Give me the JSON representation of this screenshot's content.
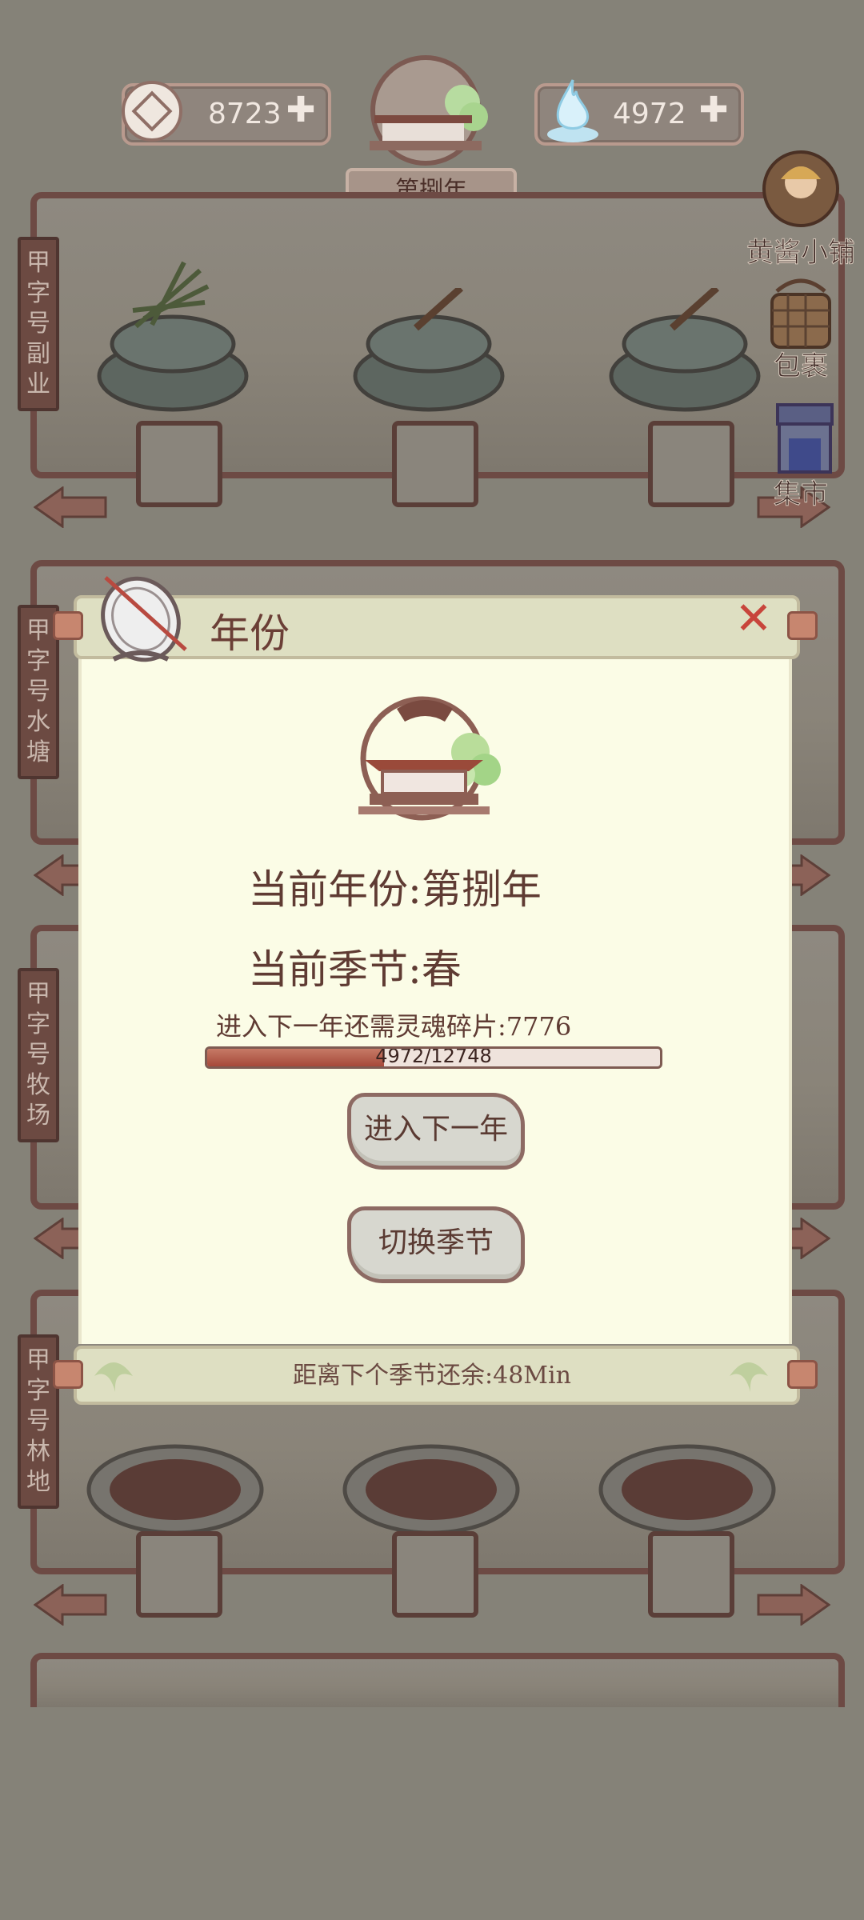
{
  "header": {
    "coins": "8723",
    "soul_shards": "4972",
    "year_badge": "第捌年"
  },
  "side_menu": [
    {
      "label": "黄酱小铺"
    },
    {
      "label": "包裹"
    },
    {
      "label": "集市"
    }
  ],
  "sections": [
    {
      "label": "甲字号副业"
    },
    {
      "label": "甲字号水塘"
    },
    {
      "label": "甲字号牧场"
    },
    {
      "label": "甲字号林地"
    }
  ],
  "modal": {
    "title": "年份",
    "current_year": "当前年份:第捌年",
    "current_season": "当前季节:春",
    "requirement": "进入下一年还需灵魂碎片:7776",
    "progress_text": "4972/12748",
    "progress_value": 0.39,
    "next_year_button": "进入下一年",
    "switch_season_button": "切换季节",
    "footer": "距离下个季节还余:48Min"
  },
  "colors": {
    "background": "#858278",
    "modal_body": "#fbfce6",
    "frame": "#6d4a44",
    "close": "#c8453b",
    "progress_fill": "#a6493a"
  }
}
